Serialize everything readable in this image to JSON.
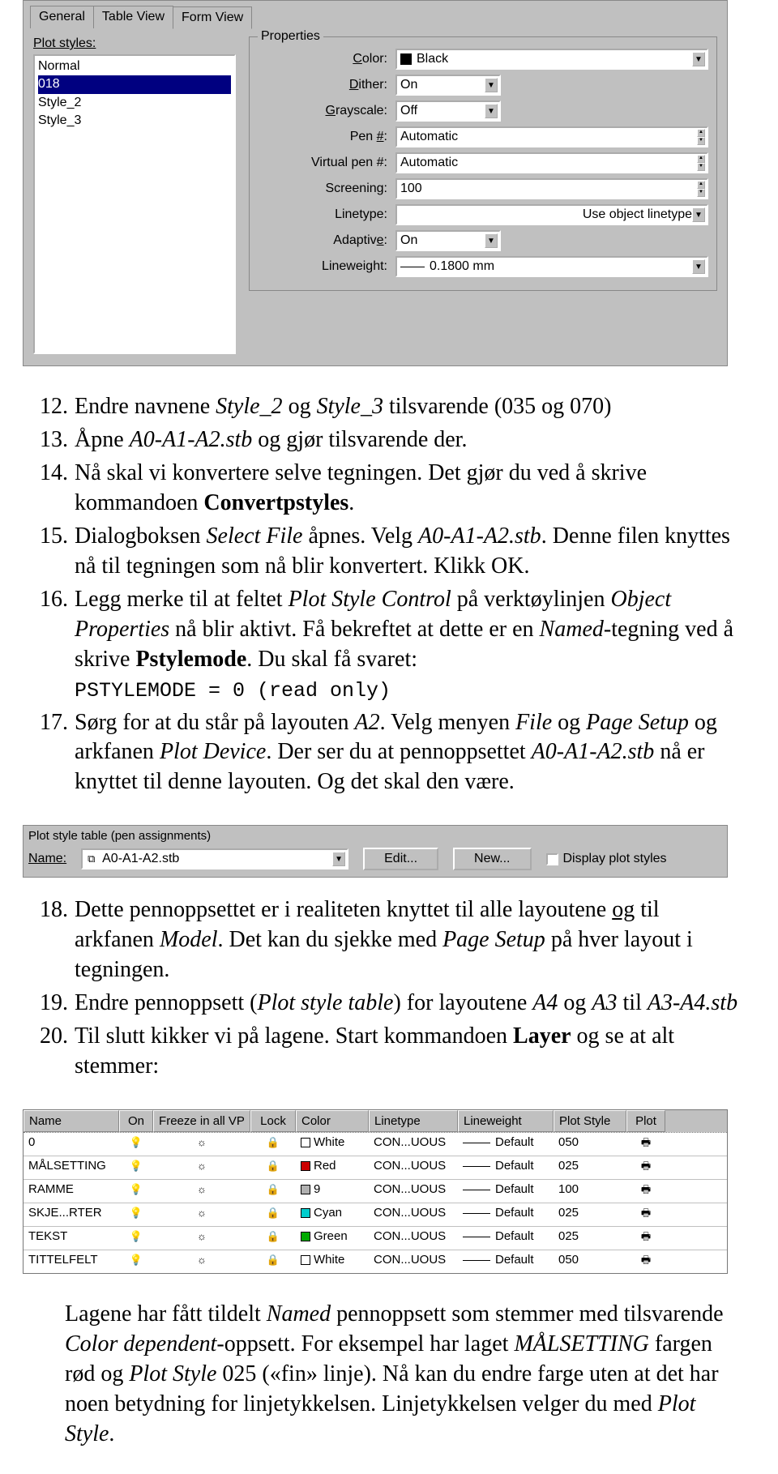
{
  "plot_editor": {
    "tabs": {
      "general": "General",
      "table_view": "Table View",
      "form_view": "Form View"
    },
    "styles_label": "Plot styles:",
    "styles": [
      "Normal",
      "018",
      "Style_2",
      "Style_3"
    ],
    "selected_style": "018",
    "properties_label": "Properties",
    "rows": {
      "color_label": "Color:",
      "color_value": "Black",
      "dither_label": "Dither:",
      "dither_value": "On",
      "grayscale_label": "Grayscale:",
      "grayscale_value": "Off",
      "pen_label": "Pen #:",
      "pen_value": "Automatic",
      "vpen_label": "Virtual pen #:",
      "vpen_value": "Automatic",
      "screen_label": "Screening:",
      "screen_value": "100",
      "linetype_label": "Linetype:",
      "linetype_value": "Use object linetype",
      "adaptive_label": "Adaptive:",
      "adaptive_value": "On",
      "lineweight_label": "Lineweight:",
      "lineweight_value": "0.1800 mm"
    }
  },
  "steps": {
    "s12": {
      "num": "12.",
      "t1": "Endre navnene ",
      "i1": "Style_2",
      "t2": " og ",
      "i2": "Style_3",
      "t3": " tilsvarende (035 og 070)"
    },
    "s13": {
      "num": "13.",
      "t1": "Åpne ",
      "i1": "A0-A1-A2.stb",
      "t2": " og gjør tilsvarende der."
    },
    "s14": {
      "num": "14.",
      "t1": "Nå skal vi konvertere selve tegningen. Det gjør du ved å skrive kommandoen ",
      "b1": "Convertpstyles",
      "t2": "."
    },
    "s15": {
      "num": "15.",
      "t1": "Dialogboksen ",
      "i1": "Select File",
      "t2": " åpnes. Velg ",
      "i2": "A0-A1-A2.stb",
      "t3": ". Denne filen knyttes nå til tegningen som nå blir konvertert. Klikk OK."
    },
    "s16": {
      "num": "16.",
      "t1": "Legg merke til at feltet ",
      "i1": "Plot Style Control",
      "t2": " på verktøylinjen ",
      "i2": "Object Properties",
      "t3": " nå blir aktivt. Få bekreftet at dette er en ",
      "i3": "Named",
      "t4": "-tegning ved å skrive ",
      "b1": "Pstylemode",
      "t5": ". Du skal få svaret:",
      "mono": "PSTYLEMODE = 0 (read only)"
    },
    "s17": {
      "num": "17.",
      "t1": "Sørg for at du står på layouten ",
      "i1": "A2",
      "t2": ". Velg menyen ",
      "i2": "File",
      "t3": " og ",
      "i3": "Page Setup",
      "t4": " og arkfanen ",
      "i4": "Plot Device",
      "t5": ". Der ser du at pennoppsettet ",
      "i5": "A0-A1-A2.stb",
      "t6": " nå er knyttet til denne layouten. Og det skal den være."
    },
    "s18": {
      "num": "18.",
      "t1": "Dette pennoppsettet er i realiteten knyttet til alle layoutene ",
      "u1": "og",
      "t2": " til arkfanen ",
      "i1": "Model",
      "t3": ". Det kan du sjekke med ",
      "i2": "Page Setup",
      "t4": " på hver layout i tegningen."
    },
    "s19": {
      "num": "19.",
      "t1": "Endre pennoppsett (",
      "i1": "Plot style table",
      "t2": ") for layoutene ",
      "i2": "A4",
      "t3": " og ",
      "i3": "A3",
      "t4": " til ",
      "i4": "A3-A4.stb"
    },
    "s20": {
      "num": "20.",
      "t1": "Til slutt kikker vi på lagene. Start kommandoen ",
      "b1": "Layer",
      "t2": " og se at alt stemmer:"
    }
  },
  "pstable": {
    "title": "Plot style table (pen assignments)",
    "name_label": "Name:",
    "name_value": "A0-A1-A2.stb",
    "edit": "Edit...",
    "new": "New...",
    "display": "Display plot styles"
  },
  "layer_table": {
    "headers": {
      "name": "Name",
      "on": "On",
      "freeze": "Freeze in all VP",
      "lock": "Lock",
      "color": "Color",
      "linetype": "Linetype",
      "lineweight": "Lineweight",
      "plotstyle": "Plot Style",
      "plot": "Plot"
    },
    "rows": [
      {
        "name": "0",
        "color_name": "White",
        "swatch": "#ffffff",
        "linetype": "CON...UOUS",
        "lw": "Default",
        "ps": "050"
      },
      {
        "name": "MÅLSETTING",
        "color_name": "Red",
        "swatch": "#cc0000",
        "linetype": "CON...UOUS",
        "lw": "Default",
        "ps": "025"
      },
      {
        "name": "RAMME",
        "color_name": "9",
        "swatch": "#b0b0b0",
        "linetype": "CON...UOUS",
        "lw": "Default",
        "ps": "100"
      },
      {
        "name": "SKJE...RTER",
        "color_name": "Cyan",
        "swatch": "#00cccc",
        "linetype": "CON...UOUS",
        "lw": "Default",
        "ps": "025"
      },
      {
        "name": "TEKST",
        "color_name": "Green",
        "swatch": "#00aa00",
        "linetype": "CON...UOUS",
        "lw": "Default",
        "ps": "025"
      },
      {
        "name": "TITTELFELT",
        "color_name": "White",
        "swatch": "#ffffff",
        "linetype": "CON...UOUS",
        "lw": "Default",
        "ps": "050"
      }
    ]
  },
  "post": {
    "t1": "Lagene har fått tildelt ",
    "i1": "Named",
    "t2": " pennoppsett som stemmer med tilsvarende ",
    "i2": "Color dependent",
    "t3": "-oppsett. For eksempel har laget ",
    "i3": "MÅLSETTING",
    "t4": " fargen rød og ",
    "i4": "Plot Style",
    "t5": " 025 («fin» linje). Nå kan du endre farge uten at det har noen betydning for linjetykkelsen. Linjetykkelsen velger du med ",
    "i5": "Plot Style",
    "t6": "."
  }
}
